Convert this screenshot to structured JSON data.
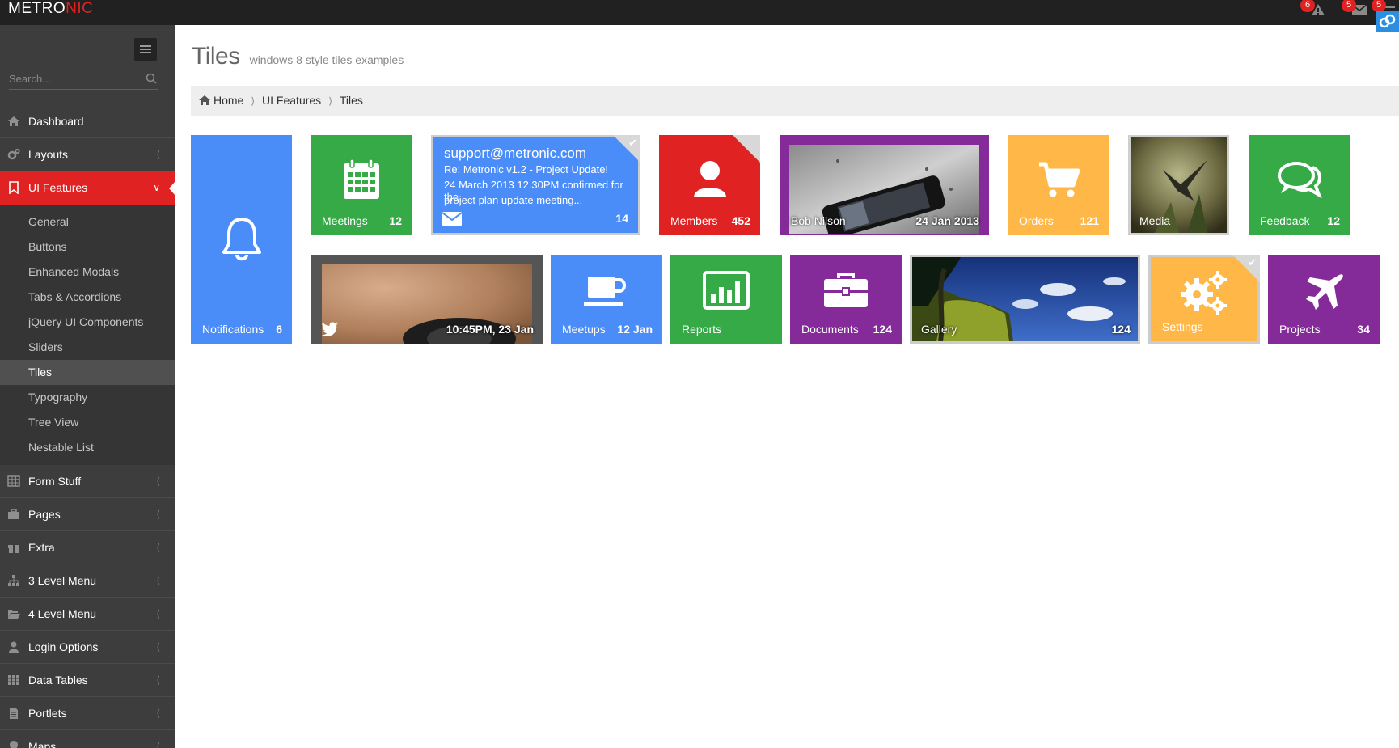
{
  "app": {
    "logo_main": "METRO",
    "logo_accent": "NIC"
  },
  "topbar": {
    "notifications": {
      "icon": "warning-icon",
      "count": "6"
    },
    "inbox": {
      "icon": "envelope-icon",
      "count": "5"
    },
    "tasks": {
      "icon": "tasks-icon",
      "count": "5"
    }
  },
  "sidebar": {
    "search_placeholder": "Search...",
    "items": [
      {
        "label": "Dashboard",
        "icon": "home-icon"
      },
      {
        "label": "Layouts",
        "icon": "cogs-icon"
      },
      {
        "label": "UI Features",
        "icon": "bookmark-icon"
      },
      {
        "label": "Form Stuff",
        "icon": "table-icon"
      },
      {
        "label": "Pages",
        "icon": "briefcase-icon"
      },
      {
        "label": "Extra",
        "icon": "gift-icon"
      },
      {
        "label": "3 Level Menu",
        "icon": "sitemap-icon"
      },
      {
        "label": "4 Level Menu",
        "icon": "folder-open-icon"
      },
      {
        "label": "Login Options",
        "icon": "user-icon"
      },
      {
        "label": "Data Tables",
        "icon": "th-icon"
      },
      {
        "label": "Portlets",
        "icon": "file-text-icon"
      },
      {
        "label": "Maps",
        "icon": "map-marker-icon"
      }
    ],
    "ui_features_sub": [
      "General",
      "Buttons",
      "Enhanced Modals",
      "Tabs & Accordions",
      "jQuery UI Components",
      "Sliders",
      "Tiles",
      "Typography",
      "Tree View",
      "Nestable List"
    ]
  },
  "page": {
    "title": "Tiles",
    "subtitle": "windows 8 style tiles examples",
    "breadcrumb": [
      "Home",
      "UI Features",
      "Tiles"
    ]
  },
  "tiles": {
    "notifications": {
      "name": "Notifications",
      "num": "6"
    },
    "meetings": {
      "name": "Meetings",
      "num": "12"
    },
    "mail": {
      "from": "support@metronic.com",
      "subject": "Re: Metronic v1.2 - Project Update!",
      "body1": "24 March 2013 12.30PM confirmed for the",
      "body2": "project plan update meeting...",
      "num": "14"
    },
    "members": {
      "name": "Members",
      "num": "452"
    },
    "phone": {
      "name": "Bob Nilson",
      "num": "24 Jan 2013"
    },
    "orders": {
      "name": "Orders",
      "num": "121"
    },
    "media": {
      "name": "Media"
    },
    "feedback": {
      "name": "Feedback",
      "num": "12"
    },
    "tweet": {
      "num": "10:45PM, 23 Jan"
    },
    "meetups": {
      "name": "Meetups",
      "num": "12 Jan"
    },
    "reports": {
      "name": "Reports"
    },
    "documents": {
      "name": "Documents",
      "num": "124"
    },
    "gallery": {
      "name": "Gallery",
      "num": "124"
    },
    "settings": {
      "name": "Settings"
    },
    "projects": {
      "name": "Projects",
      "num": "34"
    }
  },
  "colors": {
    "blue": "#4b8df8",
    "green": "#35aa47",
    "red": "#e02222",
    "purple": "#852b99",
    "yellow": "#ffb848",
    "sidebar": "#3d3d3d"
  }
}
